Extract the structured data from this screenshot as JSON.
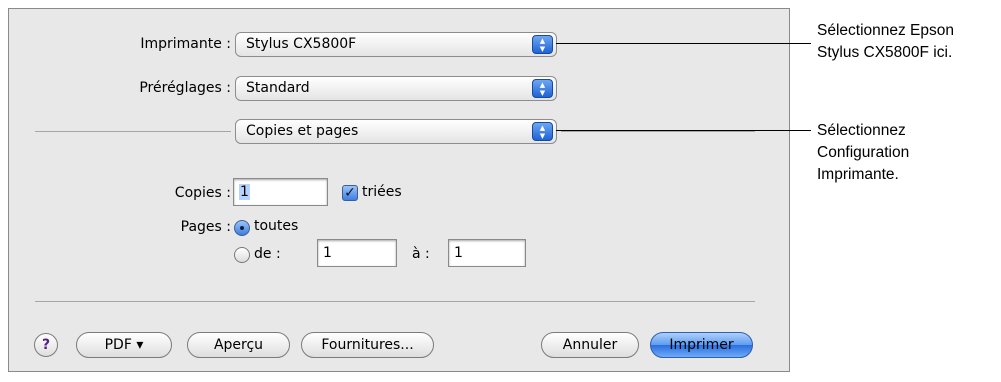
{
  "dialog": {
    "printer": {
      "label": "Imprimante :",
      "value": "Stylus CX5800F"
    },
    "presets": {
      "label": "Préréglages :",
      "value": "Standard"
    },
    "pane": {
      "value": "Copies et pages"
    },
    "copies": {
      "label": "Copies :",
      "value": "1",
      "collated_label": "triées",
      "collated": true
    },
    "pages": {
      "label": "Pages :",
      "all_label": "toutes",
      "all_selected": true,
      "from_label": "de :",
      "from_value": "1",
      "to_label": "à :",
      "to_value": "1"
    },
    "buttons": {
      "help": "?",
      "pdf": "PDF ▾",
      "preview": "Aperçu",
      "supplies": "Fournitures...",
      "cancel": "Annuler",
      "print": "Imprimer"
    }
  },
  "callouts": {
    "printer_note_line1": "Sélectionnez Epson",
    "printer_note_line2": "Stylus CX5800F ici.",
    "pane_note_line1": "Sélectionnez",
    "pane_note_line2": "Configuration",
    "pane_note_line3": "Imprimante."
  },
  "icons": {
    "popup_arrows": "updown-chevron-icon",
    "checkbox": "checkmark-icon",
    "radio": "radio-dot-icon",
    "help": "question-mark-icon"
  },
  "colors": {
    "dialog_bg": "#e8e8e8",
    "aqua_blue": "#3f7ee0",
    "help_glyph": "#5a1e8c"
  }
}
